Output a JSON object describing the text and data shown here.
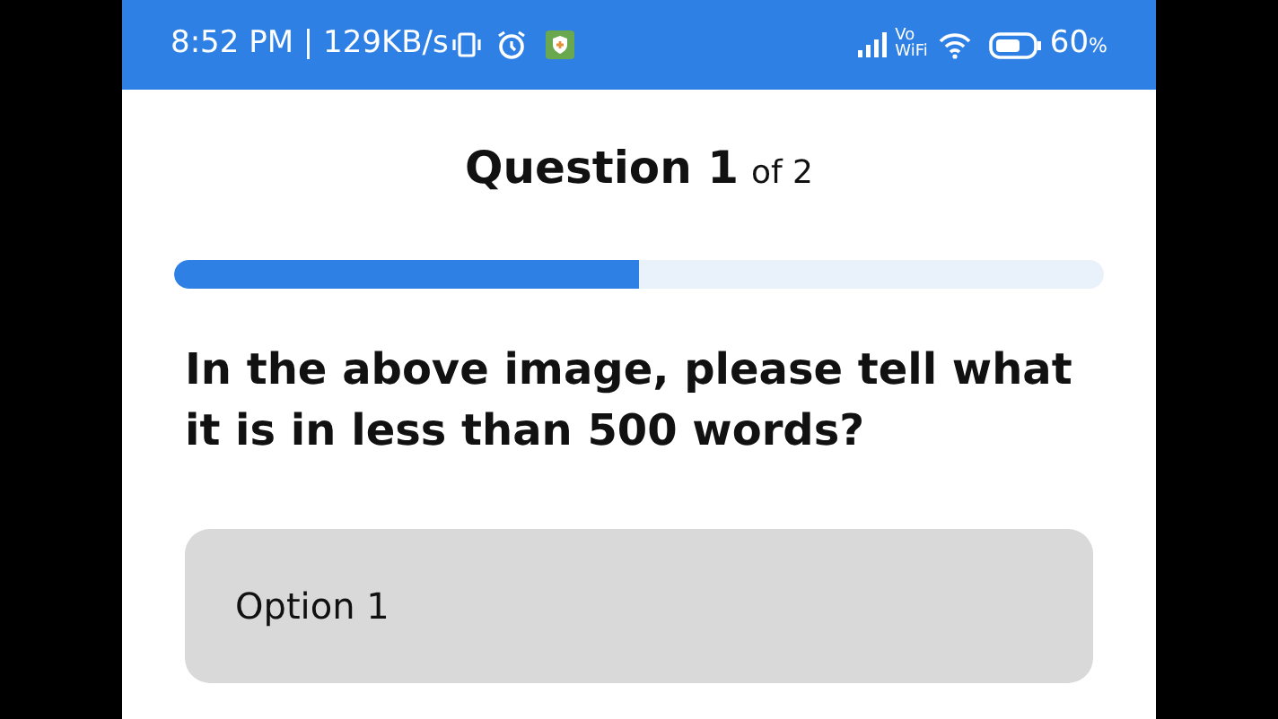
{
  "status_bar": {
    "time": "8:52 PM | 129KB/s",
    "vowifi": [
      "Vo",
      "WiFi"
    ],
    "battery": "60",
    "battery_unit": "%"
  },
  "header": {
    "title": "Question 1",
    "suffix": "of 2"
  },
  "progress": {
    "level": 0.5
  },
  "question": "In the above image, please tell what it is in less than 500 words?",
  "options": [
    {
      "label": "Option 1",
      "selected": false
    }
  ]
}
